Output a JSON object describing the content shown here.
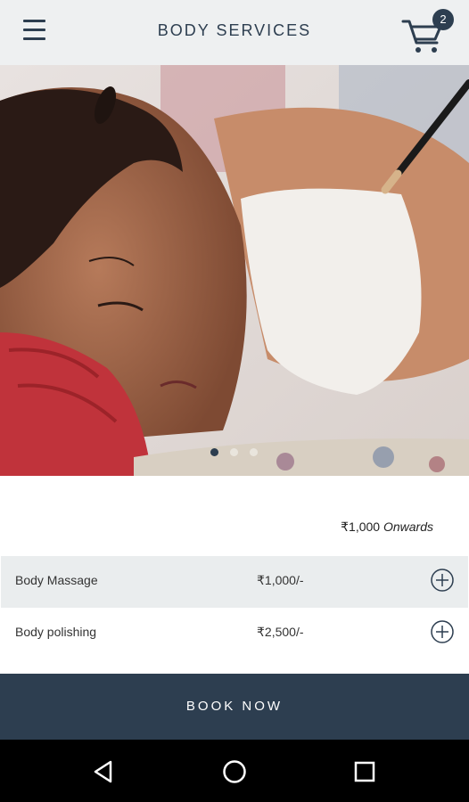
{
  "header": {
    "title": "BODY SERVICES",
    "cart_count": "2",
    "menu_icon": "hamburger-icon",
    "cart_icon": "cart-icon"
  },
  "carousel": {
    "slide_count": 3,
    "active_index": 0
  },
  "summary": {
    "currency": "₹",
    "amount": "1,000",
    "suffix": "Onwards"
  },
  "services": [
    {
      "name": "Body Massage",
      "price": "₹1,000/-"
    },
    {
      "name": "Body polishing",
      "price": "₹2,500/-"
    }
  ],
  "actions": {
    "book_label": "BOOK NOW"
  },
  "system_nav": {
    "back_icon": "back-triangle-icon",
    "home_icon": "home-circle-icon",
    "recents_icon": "recents-square-icon"
  },
  "colors": {
    "primary": "#2d3e50",
    "header_bg": "#eef0f1",
    "row_alt": "#eaedee"
  }
}
